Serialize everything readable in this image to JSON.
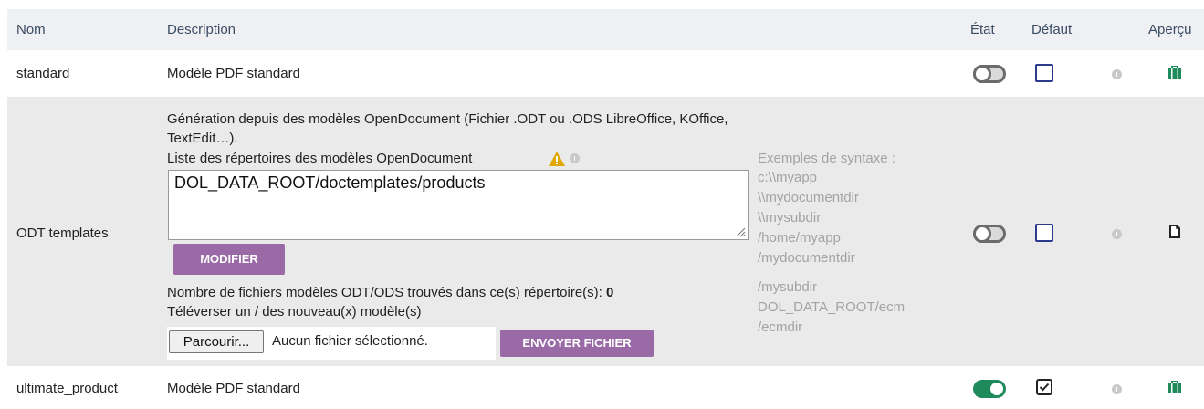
{
  "header": {
    "nom": "Nom",
    "description": "Description",
    "etat": "État",
    "defaut": "Défaut",
    "apercu": "Aperçu"
  },
  "rows": [
    {
      "name": "standard",
      "description": "Modèle PDF standard",
      "state": "off",
      "default": false
    },
    {
      "name": "ODT templates",
      "desc_line1": "Génération depuis des modèles OpenDocument (Fichier .ODT ou .ODS LibreOffice, KOffice,",
      "desc_line2": "TextEdit…).",
      "dir_label": "Liste des répertoires des modèles OpenDocument",
      "dir_value": "DOL_DATA_ROOT/doctemplates/products",
      "modify_label": "MODIFIER",
      "count_label": "Nombre de fichiers modèles ODT/ODS trouvés dans ce(s) répertoire(s):",
      "count_value": "0",
      "upload_label": "Téléverser un / des nouveau(x) modèle(s)",
      "browse_label": "Parcourir...",
      "no_file_label": "Aucun fichier sélectionné.",
      "send_label": "ENVOYER FICHIER",
      "examples_title": "Exemples de syntaxe :",
      "examples": [
        "c:\\\\myapp",
        "\\\\mydocumentdir",
        "\\\\mysubdir",
        "/home/myapp",
        "/mydocumentdir",
        "/mysubdir",
        "DOL_DATA_ROOT/ecm",
        "/ecmdir"
      ],
      "state": "off",
      "default": false
    },
    {
      "name": "ultimate_product",
      "description": "Modèle PDF standard",
      "state": "on",
      "default": true
    }
  ],
  "colors": {
    "accent_purple": "#9a6aa6",
    "toggle_on": "#1f8a5b",
    "preview_green": "#1f8a5b",
    "warning": "#e0a800"
  }
}
